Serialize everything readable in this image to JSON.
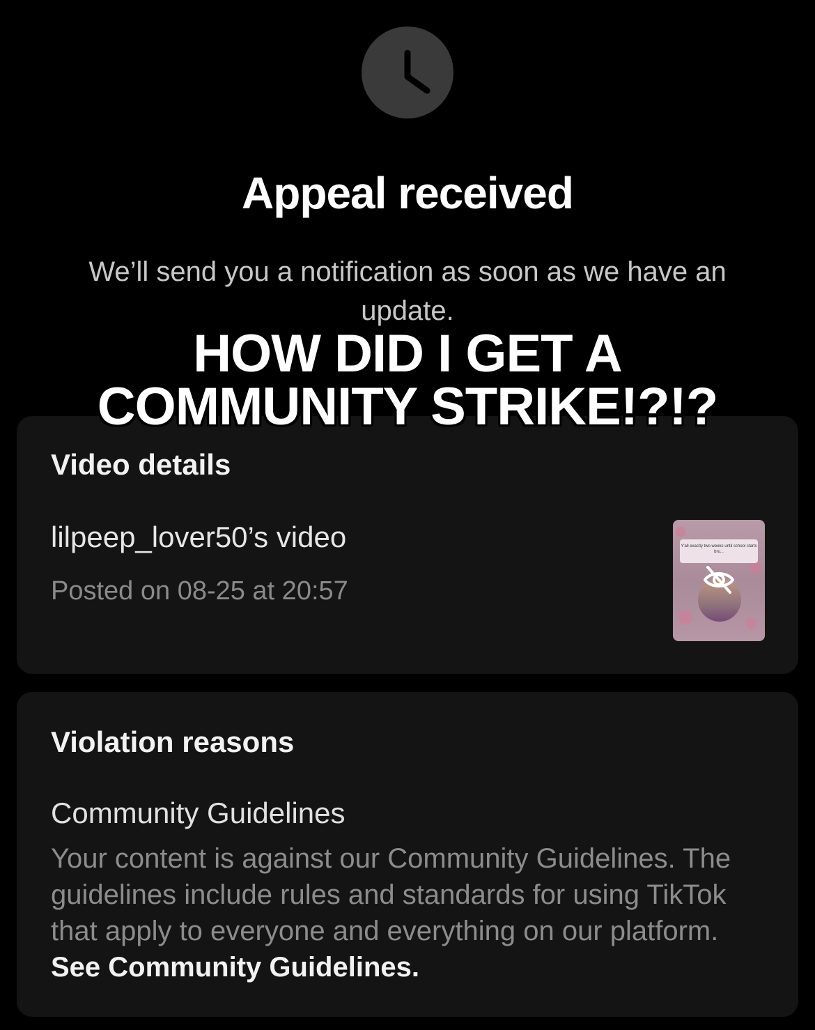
{
  "header": {
    "status_icon": "clock-icon",
    "title": "Appeal received",
    "subtitle": "We’ll send you a notification as soon as we have an update."
  },
  "overlay_caption": {
    "line1": "HOW DID I GET A",
    "line2": "COMMUNITY STRIKE!?!?"
  },
  "video_details": {
    "heading": "Video details",
    "video_title": "lilpeep_lover50’s video",
    "posted": "Posted on 08-25 at 20:57",
    "thumbnail": {
      "caption": "Y'all exactly two weeks until school starts bru...",
      "status_icon": "eye-off-icon"
    }
  },
  "violation": {
    "heading": "Violation reasons",
    "reason_title": "Community Guidelines",
    "reason_body": "Your content is against our Community Guidelines. The guidelines include rules and standards for using TikTok that apply to everyone and everything on our platform.",
    "link_label": "See Community Guidelines."
  },
  "colors": {
    "background": "#000000",
    "card": "#141414",
    "clock_circle": "#3a3a3a",
    "muted_text": "#8c8c8c"
  }
}
